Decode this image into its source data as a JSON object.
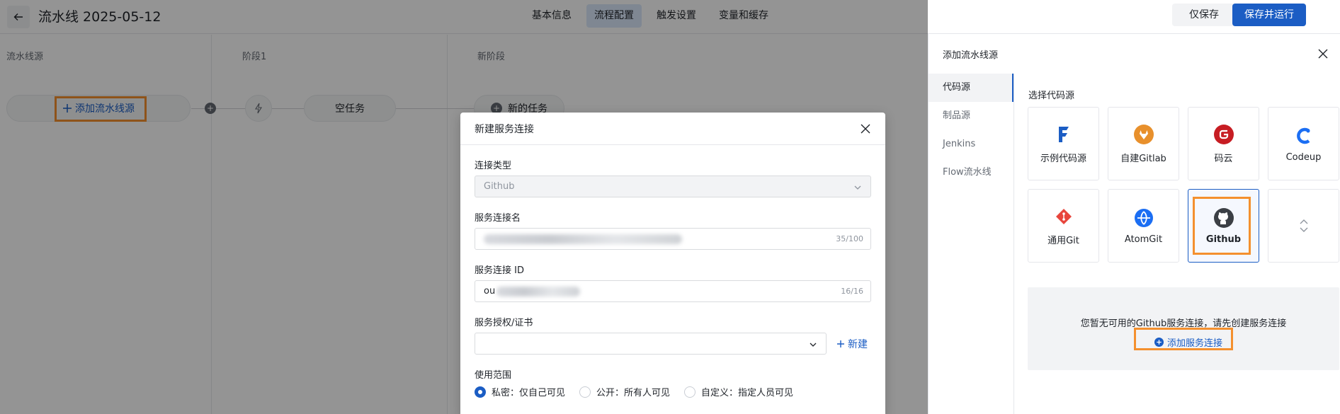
{
  "header": {
    "title": "流水线 2025-05-12",
    "tabs": [
      {
        "label": "基本信息"
      },
      {
        "label": "流程配置"
      },
      {
        "label": "触发设置"
      },
      {
        "label": "变量和缓存"
      }
    ],
    "save_label": "仅保存",
    "run_label": "保存并运行"
  },
  "canvas": {
    "columns": [
      "流水线源",
      "阶段1",
      "新阶段"
    ],
    "add_source_label": "添加流水线源",
    "empty_task_label": "空任务",
    "new_task_label": "新的任务"
  },
  "modal": {
    "title": "新建服务连接",
    "conn_type_label": "连接类型",
    "conn_type_value": "Github",
    "name_label": "服务连接名",
    "name_count": "35/100",
    "id_label": "服务连接 ID",
    "id_value_prefix": "ou",
    "id_count": "16/16",
    "auth_label": "服务授权/证书",
    "new_label": "新建",
    "scope_label": "使用范围",
    "scope_options": [
      {
        "label": "私密：仅自己可见",
        "selected": true
      },
      {
        "label": "公开：所有人可见",
        "selected": false
      },
      {
        "label": "自定义：指定人员可见",
        "selected": false
      }
    ]
  },
  "drawer": {
    "title": "添加流水线源",
    "nav": [
      {
        "label": "代码源",
        "active": true
      },
      {
        "label": "制品源",
        "active": false
      },
      {
        "label": "Jenkins",
        "active": false
      },
      {
        "label": "Flow流水线",
        "active": false
      }
    ],
    "pick_label": "选择代码源",
    "sources": [
      {
        "label": "示例代码源",
        "icon": "flow-f-icon"
      },
      {
        "label": "自建Gitlab",
        "icon": "gitlab-icon"
      },
      {
        "label": "码云",
        "icon": "gitee-icon"
      },
      {
        "label": "Codeup",
        "icon": "codeup-icon"
      },
      {
        "label": "通用Git",
        "icon": "git-icon"
      },
      {
        "label": "AtomGit",
        "icon": "atomgit-icon"
      },
      {
        "label": "Github",
        "icon": "github-icon",
        "selected": true
      },
      {
        "label": "",
        "icon": "expand-icon"
      }
    ],
    "empty_text": "您暂无可用的Github服务连接，请先创建服务连接",
    "add_conn_label": "添加服务连接"
  },
  "colors": {
    "primary": "#1b5dc4",
    "highlight": "#f4902e",
    "gitlab": "#e8902c",
    "gitee": "#c71d23",
    "git": "#e8453c",
    "codeup": "#1b6ef3"
  }
}
